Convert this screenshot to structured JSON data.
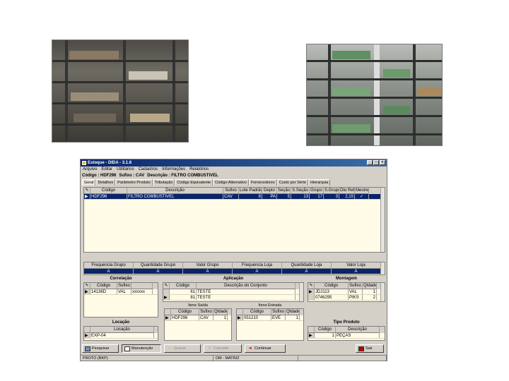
{
  "window": {
    "title": "Estoque - DIDA - 3.1.6",
    "controls": [
      "_",
      "□",
      "×"
    ]
  },
  "menu": [
    "Arquivo",
    "Editar",
    "Utilitários",
    "Cadastros",
    "Informações",
    "Relatórios"
  ],
  "info": {
    "codigo": "Código : HDF296",
    "sufixo": "Sufixo : CAV",
    "descricao": "Descrição : FILTRO COMBUSTIVEL"
  },
  "tabs": [
    "Geral",
    "Detalhes",
    "Parâmetro Produto",
    "Tributação",
    "Código Equivalente",
    "Código Alternativo",
    "Fornecedores",
    "Custo por Série",
    "Hierarquia"
  ],
  "active_tab": "Geral",
  "main_grid": {
    "headers": [
      "Código",
      "Descrição",
      "Sufixo",
      "Lote Padrão",
      "Depto",
      "Seção",
      "S.Seção",
      "Grupo",
      "S.Grupo",
      "Dto Ref.",
      "Mestre"
    ],
    "rows": [
      [
        "HDF296",
        "FILTRO COMBUSTIVEL",
        "CAV",
        "8",
        "PA",
        "5",
        "13",
        "17",
        "3",
        "2,15",
        "✓"
      ]
    ]
  },
  "group_grid": {
    "headers": [
      "Frequencia Grupo",
      "Quantidade Grupo",
      "Valor Grupo",
      "Frequencia Loja",
      "Quantidade Loja",
      "Valor Loja"
    ],
    "rows": [
      [
        "A",
        "A",
        "A",
        "A",
        "A",
        "A"
      ]
    ]
  },
  "correlacao": {
    "title": "Correlação",
    "headers": [
      "Código",
      "Sufixo"
    ],
    "rows": [
      [
        "14136D",
        "VAL",
        "xxxxxx"
      ]
    ]
  },
  "aplicacao": {
    "title": "Aplicação",
    "headers": [
      "Código",
      "Descrição do Conjunto"
    ],
    "rows": [
      [
        "61",
        "TESTE"
      ],
      [
        "81",
        "TESTE"
      ]
    ]
  },
  "montagem": {
    "title": "Montagem",
    "headers": [
      "Código",
      "Sufixo",
      "Qtdade"
    ],
    "rows": [
      [
        "JDJ113",
        "VAL",
        "1"
      ],
      [
        "0746295",
        "PIKS",
        "2"
      ]
    ]
  },
  "itens_saida": {
    "title": "Itens Saída",
    "headers": [
      "Código",
      "Sufixo",
      "Qtdade"
    ],
    "rows": [
      [
        "HDF296",
        "CAV",
        "1"
      ]
    ]
  },
  "itens_entrada": {
    "title": "Itens Entrada",
    "headers": [
      "Código",
      "Sufixo",
      "Qtdade"
    ],
    "rows": [
      [
        "051210",
        "EVE",
        "1"
      ]
    ]
  },
  "locacao": {
    "title": "Locação",
    "headers": [
      "Locação"
    ],
    "rows": [
      [
        "EXP-04"
      ]
    ]
  },
  "tipo_produto": {
    "title": "Tipo Produto",
    "headers": [
      "Código",
      "Descrição"
    ],
    "rows": [
      [
        "1",
        "PEÇAS"
      ]
    ]
  },
  "buttons": {
    "pesquisar": "Pesquisar",
    "manutencao": "Manutenção",
    "gravar": "Gravar",
    "cancelar": "Cancelar",
    "continuar": "Continuar",
    "sair": "Sair"
  },
  "status": {
    "left": "PROTO (BKP)",
    "center": "DM - MATRIZ"
  },
  "colors": {
    "selection": "#0a246a",
    "grid_bg": "#fffbe6",
    "window_bg": "#d4d0c8"
  }
}
